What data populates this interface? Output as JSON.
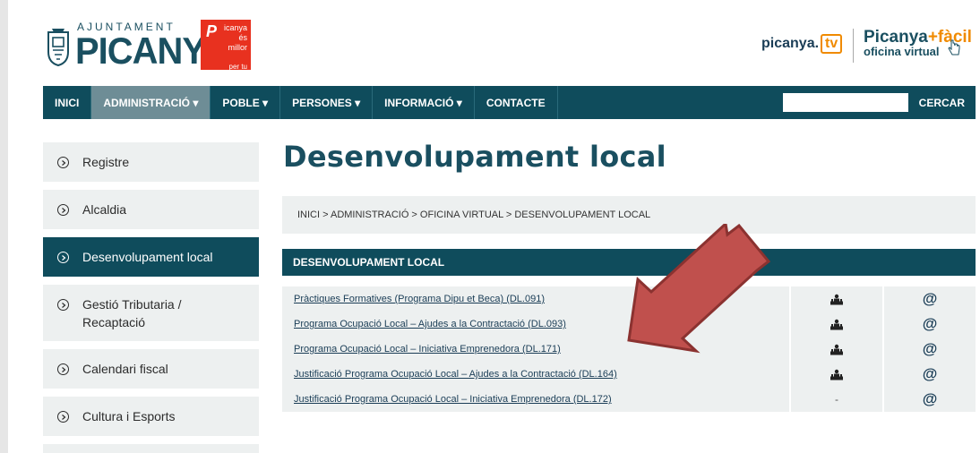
{
  "header": {
    "logo_small": "AJUNTAMENT",
    "logo_big": "PICANYA",
    "badge": {
      "p": "P",
      "line1": "icanya",
      "line2": "és millor",
      "line3": "per tu"
    },
    "picanya_tv": {
      "prefix": "picanya.",
      "box": "tv"
    },
    "picanya_facil": {
      "name": "Picanya",
      "plus": "+fàcil",
      "sub": "oficina virtual"
    }
  },
  "nav": {
    "items": [
      "INICI",
      "ADMINISTRACIÓ ▾",
      "POBLE ▾",
      "PERSONES ▾",
      "INFORMACIÓ ▾",
      "CONTACTE"
    ],
    "search_label": "CERCAR",
    "search_placeholder": ""
  },
  "sidebar": {
    "items": [
      "Registre",
      "Alcaldia",
      "Desenvolupament local",
      "Gestió Tributaria / Recaptació",
      "Calendari fiscal",
      "Cultura i Esports"
    ]
  },
  "page": {
    "title": "Desenvolupament local",
    "breadcrumb": "INICI > ADMINISTRACIÓ > OFICINA VIRTUAL > DESENVOLUPAMENT LOCAL",
    "section_header": "DESENVOLUPAMENT LOCAL"
  },
  "table": {
    "rows": [
      {
        "label": "Pràctiques Formatives (Programa Dipu et Beca) (DL.091)",
        "presencial": "icon",
        "online": "@"
      },
      {
        "label": "Programa Ocupació Local – Ajudes a la Contractació (DL.093)",
        "presencial": "icon",
        "online": "@"
      },
      {
        "label": "Programa Ocupació Local – Iniciativa Emprenedora (DL.171)",
        "presencial": "icon",
        "online": "@"
      },
      {
        "label": "Justificació Programa Ocupació Local – Ajudes a la Contractació (DL.164)",
        "presencial": "icon",
        "online": "@"
      },
      {
        "label": "Justificació Programa Ocupació Local – Iniciativa Emprenedora (DL.172)",
        "presencial": "-",
        "online": "@"
      }
    ]
  },
  "colors": {
    "nav_bg": "#0f4c5c",
    "nav_active": "#6e8d96",
    "light_bg": "#edf0f0",
    "brand_red": "#e8311f",
    "accent_orange": "#f08a00",
    "arrow_red": "#c0504d"
  }
}
